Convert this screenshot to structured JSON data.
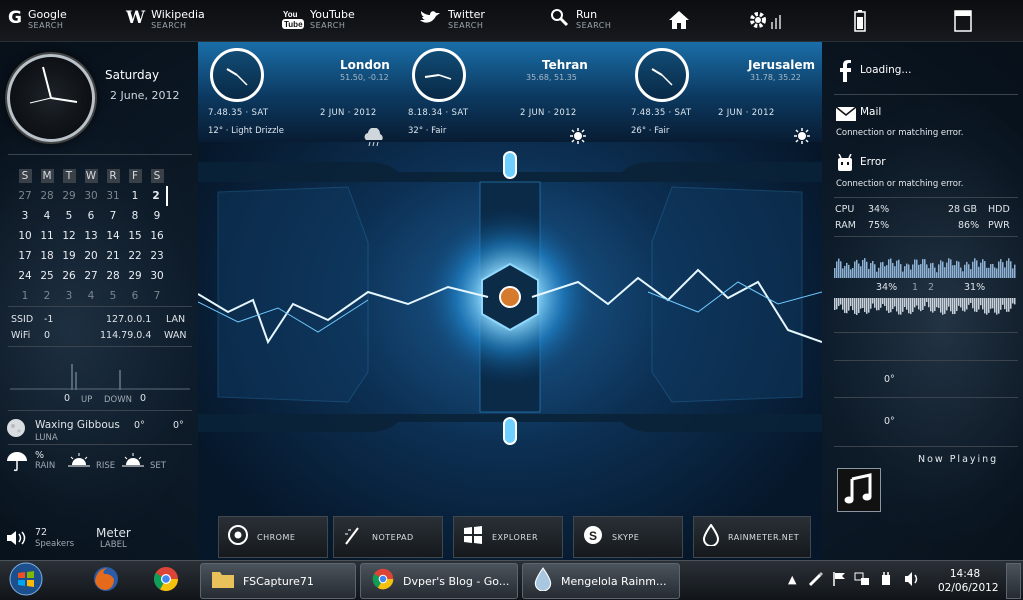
{
  "topbar": {
    "items": [
      {
        "title": "Google",
        "sub": "SEARCH",
        "icon": "google-icon"
      },
      {
        "title": "Wikipedia",
        "sub": "SEARCH",
        "icon": "wikipedia-icon"
      },
      {
        "title": "YouTube",
        "sub": "SEARCH",
        "icon": "youtube-icon"
      },
      {
        "title": "Twitter",
        "sub": "SEARCH",
        "icon": "twitter-icon"
      },
      {
        "title": "Run",
        "sub": "SEARCH",
        "icon": "search-icon"
      }
    ],
    "icons": [
      "home-icon",
      "settings-icon",
      "battery-icon",
      "window-icon"
    ]
  },
  "left": {
    "day": "Saturday",
    "date": "2 June, 2012",
    "calendar": {
      "header": [
        "S",
        "M",
        "T",
        "W",
        "R",
        "F",
        "S"
      ],
      "rows": [
        [
          "27",
          "28",
          "29",
          "30",
          "31",
          "1",
          "2"
        ],
        [
          "3",
          "4",
          "5",
          "6",
          "7",
          "8",
          "9"
        ],
        [
          "10",
          "11",
          "12",
          "13",
          "14",
          "15",
          "16"
        ],
        [
          "17",
          "18",
          "19",
          "20",
          "21",
          "22",
          "23"
        ],
        [
          "24",
          "25",
          "26",
          "27",
          "28",
          "29",
          "30"
        ],
        [
          "1",
          "2",
          "3",
          "4",
          "5",
          "6",
          "7"
        ]
      ],
      "today": "2"
    },
    "network": {
      "ssid_label": "SSID",
      "ssid": "-1",
      "lan_ip": "127.0.0.1",
      "lan_label": "LAN",
      "wifi_label": "WiFi",
      "wifi": "0",
      "wan_ip": "114.79.0.4",
      "wan_label": "WAN",
      "up_value": "0",
      "up_label": "UP",
      "down_label": "DOWN",
      "down_value": "0"
    },
    "moon": {
      "phase": "Waxing Gibbous",
      "label": "LUNA",
      "v1": "0°",
      "v2": "0°"
    },
    "weather": {
      "rain_pct": "%",
      "rain_label": "RAIN",
      "rise_label": "RISE",
      "set_label": "SET"
    },
    "volume": {
      "value": "72",
      "label": "Speakers"
    },
    "meter": {
      "title": "Meter",
      "label": "LABEL"
    }
  },
  "clocks": [
    {
      "city": "London",
      "coords": "51.50, -0.12",
      "time": "7.48.35 · SAT",
      "date": "2 JUN · 2012",
      "weather": "12° · Light Drizzle"
    },
    {
      "city": "Tehran",
      "coords": "35.68, 51.35",
      "time": "8.18.34 · SAT",
      "date": "2 JUN · 2012",
      "weather": "32° · Fair"
    },
    {
      "city": "Jerusalem",
      "coords": "31.78, 35.22",
      "time": "7.48.35 · SAT",
      "date": "2 JUN · 2012",
      "weather": "26° · Fair"
    }
  ],
  "dock": [
    "CHROME",
    "NOTEPAD",
    "EXPLORER",
    "SKYPE",
    "RAINMETER.NET"
  ],
  "right": {
    "facebook": "Loading...",
    "mail_title": "Mail",
    "mail_status": "Connection or matching error.",
    "error_title": "Error",
    "error_status": "Connection or matching error.",
    "sys": {
      "cpu_label": "CPU",
      "cpu": "34%",
      "hdd_size": "28 GB",
      "hdd_label": "HDD",
      "ram_label": "RAM",
      "ram": "75%",
      "pwr": "86%",
      "pwr_label": "PWR"
    },
    "core1": "34%",
    "core_sep1": "1",
    "core_sep2": "2",
    "core2": "31%",
    "temp1": "0°",
    "temp2": "0°",
    "now_playing": "Now Playing"
  },
  "taskbar": {
    "buttons": [
      "FSCapture71",
      "Dvper's Blog - Go...",
      "Mengelola Rainm..."
    ],
    "time": "14:48",
    "date": "02/06/2012"
  }
}
